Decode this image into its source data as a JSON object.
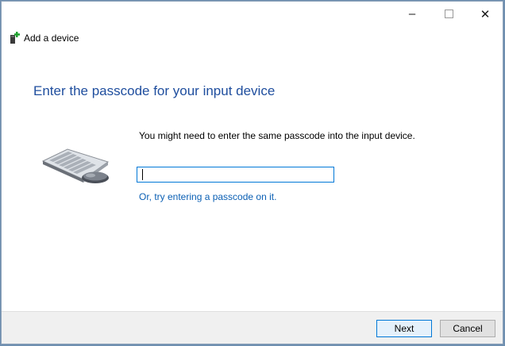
{
  "window": {
    "controls": {
      "minimize": "–",
      "maximize": "",
      "close": "✕"
    }
  },
  "header": {
    "title": "Add a device",
    "icon": "bluetooth-device-add-icon"
  },
  "main": {
    "title": "Enter the passcode for your input device",
    "instruction": "You might need to enter the same passcode into the input device.",
    "passcode": {
      "value": "",
      "placeholder": ""
    },
    "alt_link": "Or, try entering a passcode on it.",
    "illustration": "keyboard-mouse-icon"
  },
  "footer": {
    "next_label": "Next",
    "cancel_label": "Cancel"
  },
  "colors": {
    "title_blue": "#1f4e9e",
    "link_blue": "#0a5fb4",
    "accent": "#0078d7"
  }
}
